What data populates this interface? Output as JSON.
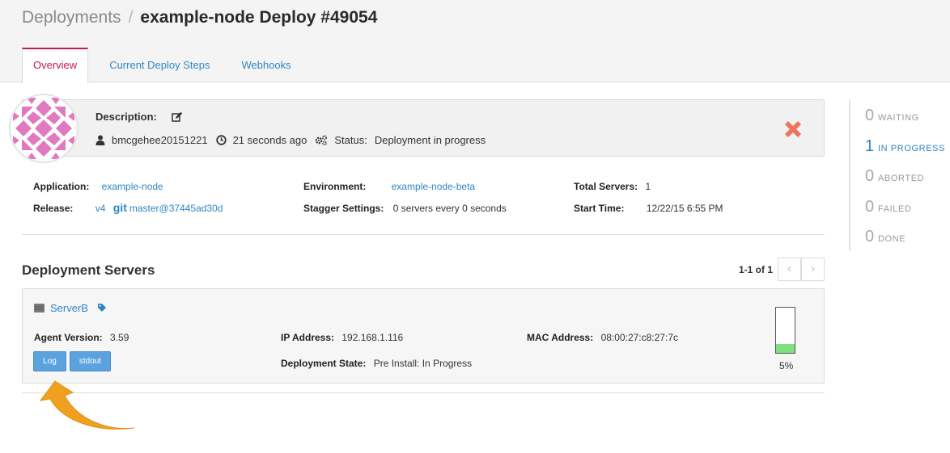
{
  "breadcrumb": {
    "root": "Deployments",
    "separator": "/",
    "title": "example-node Deploy #49054"
  },
  "tabs": [
    {
      "label": "Overview",
      "active": true
    },
    {
      "label": "Current Deploy Steps",
      "active": false
    },
    {
      "label": "Webhooks",
      "active": false
    }
  ],
  "description": {
    "label": "Description:",
    "user": "bmcgehee20151221",
    "time_ago": "21 seconds ago",
    "status_label": "Status:",
    "status_value": "Deployment in progress"
  },
  "status_counts": [
    {
      "count": "0",
      "label": "WAITING",
      "active": false
    },
    {
      "count": "1",
      "label": "IN PROGRESS",
      "active": true
    },
    {
      "count": "0",
      "label": "ABORTED",
      "active": false
    },
    {
      "count": "0",
      "label": "FAILED",
      "active": false
    },
    {
      "count": "0",
      "label": "DONE",
      "active": false
    }
  ],
  "info": {
    "application_label": "Application:",
    "application_value": "example-node",
    "release_label": "Release:",
    "release_version": "v4",
    "release_git_word": "git",
    "release_commit": "master@37445ad30d",
    "environment_label": "Environment:",
    "environment_value": "example-node-beta",
    "stagger_label": "Stagger Settings:",
    "stagger_value": "0 servers every 0 seconds",
    "total_servers_label": "Total Servers:",
    "total_servers_value": "1",
    "start_time_label": "Start Time:",
    "start_time_value": "12/22/15 6:55 PM"
  },
  "servers_section": {
    "title": "Deployment Servers",
    "pager_count": "1-1 of 1",
    "prev": "‹",
    "next": "›"
  },
  "server": {
    "name": "ServerB",
    "agent_version_label": "Agent Version:",
    "agent_version_value": "3.59",
    "ip_label": "IP Address:",
    "ip_value": "192.168.1.116",
    "mac_label": "MAC Address:",
    "mac_value": "08:00:27:c8:27:7c",
    "state_label": "Deployment State:",
    "state_value": "Pre Install: In Progress",
    "log_button": "Log",
    "stdout_button": "stdout",
    "progress_percent": 5,
    "progress_label": "5%"
  },
  "colors": {
    "accent": "#c2185b",
    "link": "#2f86c6",
    "close_x": "#f0735c",
    "progress_fill": "#7fe07f",
    "button": "#5aa3de",
    "avatar": "#e07ac0",
    "arrow": "#f0a020"
  },
  "icons": {
    "edit": "pencil-square-icon",
    "user": "user-icon",
    "clock": "clock-icon",
    "status": "cogs-icon",
    "close": "close-x-icon",
    "server": "server-icon",
    "tag": "tag-icon"
  }
}
